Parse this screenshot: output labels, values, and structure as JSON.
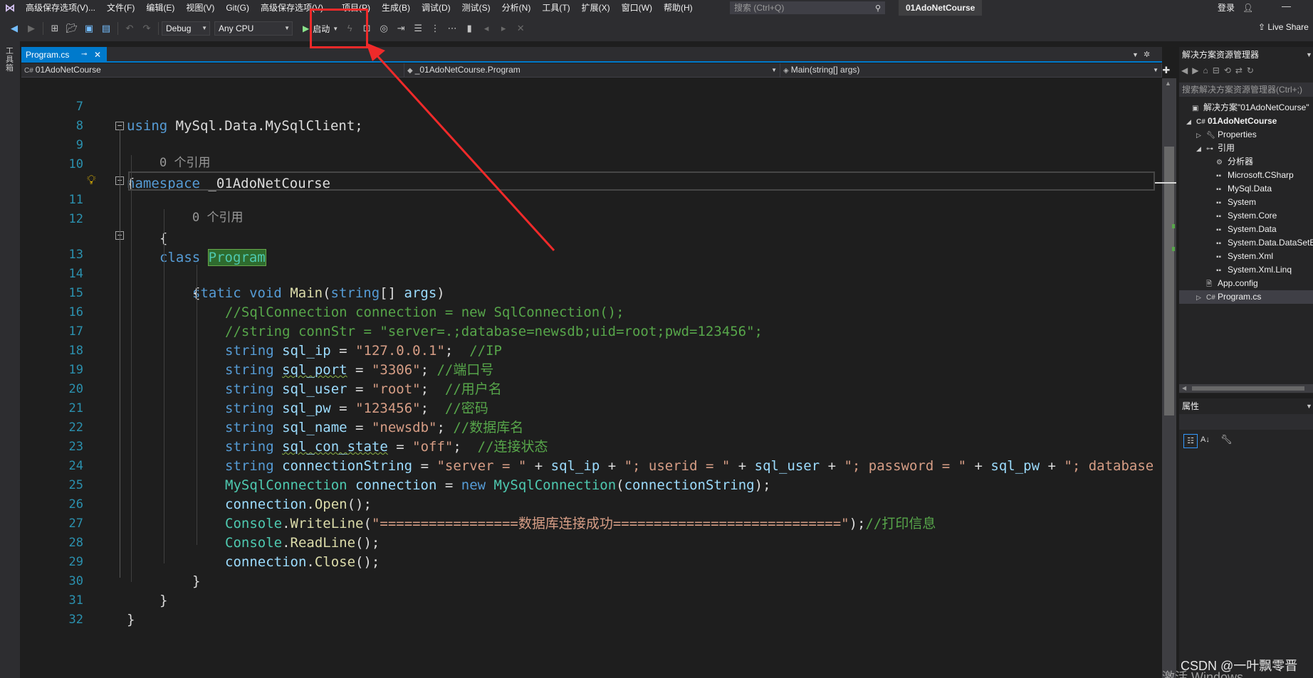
{
  "menubar": {
    "items": [
      "高级保存选项(V)...",
      "文件(F)",
      "编辑(E)",
      "视图(V)",
      "Git(G)",
      "高级保存选项(V)...",
      "项目(P)",
      "生成(B)",
      "调试(D)",
      "测试(S)",
      "分析(N)",
      "工具(T)",
      "扩展(X)",
      "窗口(W)",
      "帮助(H)"
    ],
    "search_placeholder": "搜索 (Ctrl+Q)",
    "solution_name": "01AdoNetCourse",
    "login_label": "登录"
  },
  "toolbar": {
    "config": "Debug",
    "platform": "Any CPU",
    "start_label": "启动",
    "live_share": "Live Share"
  },
  "toolbox": {
    "label": "工具箱"
  },
  "tabs": {
    "active": "Program.cs"
  },
  "navbar": {
    "project": "01AdoNetCourse",
    "type": "_01AdoNetCourse.Program",
    "member": "Main(string[] args)"
  },
  "editor": {
    "line_numbers": [
      "7",
      "8",
      "9",
      "10",
      "11",
      "12",
      "13",
      "14",
      "15",
      "16",
      "17",
      "18",
      "19",
      "20",
      "21",
      "22",
      "23",
      "24",
      "25",
      "26",
      "27",
      "28",
      "29",
      "30",
      "31",
      "32"
    ],
    "code_lens": "0 个引用",
    "lines": {
      "l7": [
        "using",
        " MySql.Data.MySqlClient;"
      ],
      "l9": [
        "namespace",
        " _01AdoNetCourse"
      ],
      "l10": "{",
      "l11": [
        "class",
        "Program"
      ],
      "l12": "{",
      "l13": [
        "static",
        "void",
        "Main",
        "(",
        "string",
        "[] ",
        "args",
        ")"
      ],
      "l14": "{",
      "l15": "//SqlConnection connection = new SqlConnection();",
      "l16": "//string connStr = \"server=.;database=newsdb;uid=root;pwd=123456\";",
      "l17": [
        "string",
        "sql_ip",
        " = ",
        "\"127.0.0.1\"",
        ";  ",
        "//IP"
      ],
      "l18": [
        "string",
        "sql_port",
        " = ",
        "\"3306\"",
        "; ",
        "//端口号"
      ],
      "l19": [
        "string",
        "sql_user",
        " = ",
        "\"root\"",
        ";  ",
        "//用户名"
      ],
      "l20": [
        "string",
        "sql_pw",
        " = ",
        "\"123456\"",
        ";  ",
        "//密码"
      ],
      "l21": [
        "string",
        "sql_name",
        " = ",
        "\"newsdb\"",
        "; ",
        "//数据库名"
      ],
      "l22": [
        "string",
        "sql_con_state",
        " = ",
        "\"off\"",
        ";  ",
        "//连接状态"
      ],
      "l23": [
        "string",
        "connectionString",
        " = ",
        "\"server = \"",
        " + ",
        "sql_ip",
        " + ",
        "\"; userid = \"",
        " + ",
        "sql_user",
        " + ",
        "\"; password = \"",
        " + ",
        "sql_pw",
        " + ",
        "\"; database =\""
      ],
      "l24": [
        "MySqlConnection",
        "connection",
        " = ",
        "new",
        "MySqlConnection",
        "(",
        "connectionString",
        ");"
      ],
      "l25": [
        "connection",
        ".",
        "Open",
        "();"
      ],
      "l26": [
        "Console",
        ".",
        "WriteLine",
        "(",
        "\"=================数据库连接成功============================\"",
        ");",
        "//打印信息"
      ],
      "l27": [
        "Console",
        ".",
        "ReadLine",
        "();"
      ],
      "l28": [
        "connection",
        ".",
        "Close",
        "();"
      ],
      "l29": "}",
      "l30": "}",
      "l31": "}"
    }
  },
  "solution_explorer": {
    "title": "解决方案资源管理器",
    "search_placeholder": "搜索解决方案资源管理器(Ctrl+;)",
    "items": [
      "解决方案\"01AdoNetCourse\"",
      "01AdoNetCourse",
      "Properties",
      "引用",
      "分析器",
      "Microsoft.CSharp",
      "MySql.Data",
      "System",
      "System.Core",
      "System.Data",
      "System.Data.DataSetExtensions",
      "System.Xml",
      "System.Xml.Linq",
      "App.config",
      "Program.cs"
    ]
  },
  "properties": {
    "title": "属性"
  },
  "watermarks": {
    "csdn": "CSDN @一叶飘零晋",
    "windows": "激活 Windows"
  },
  "colors": {
    "annotation": "#ef2a2a",
    "accent": "#007acc",
    "keyword": "#569cd6",
    "type": "#4ec9b0",
    "string": "#d69d85",
    "comment": "#57a64a"
  }
}
